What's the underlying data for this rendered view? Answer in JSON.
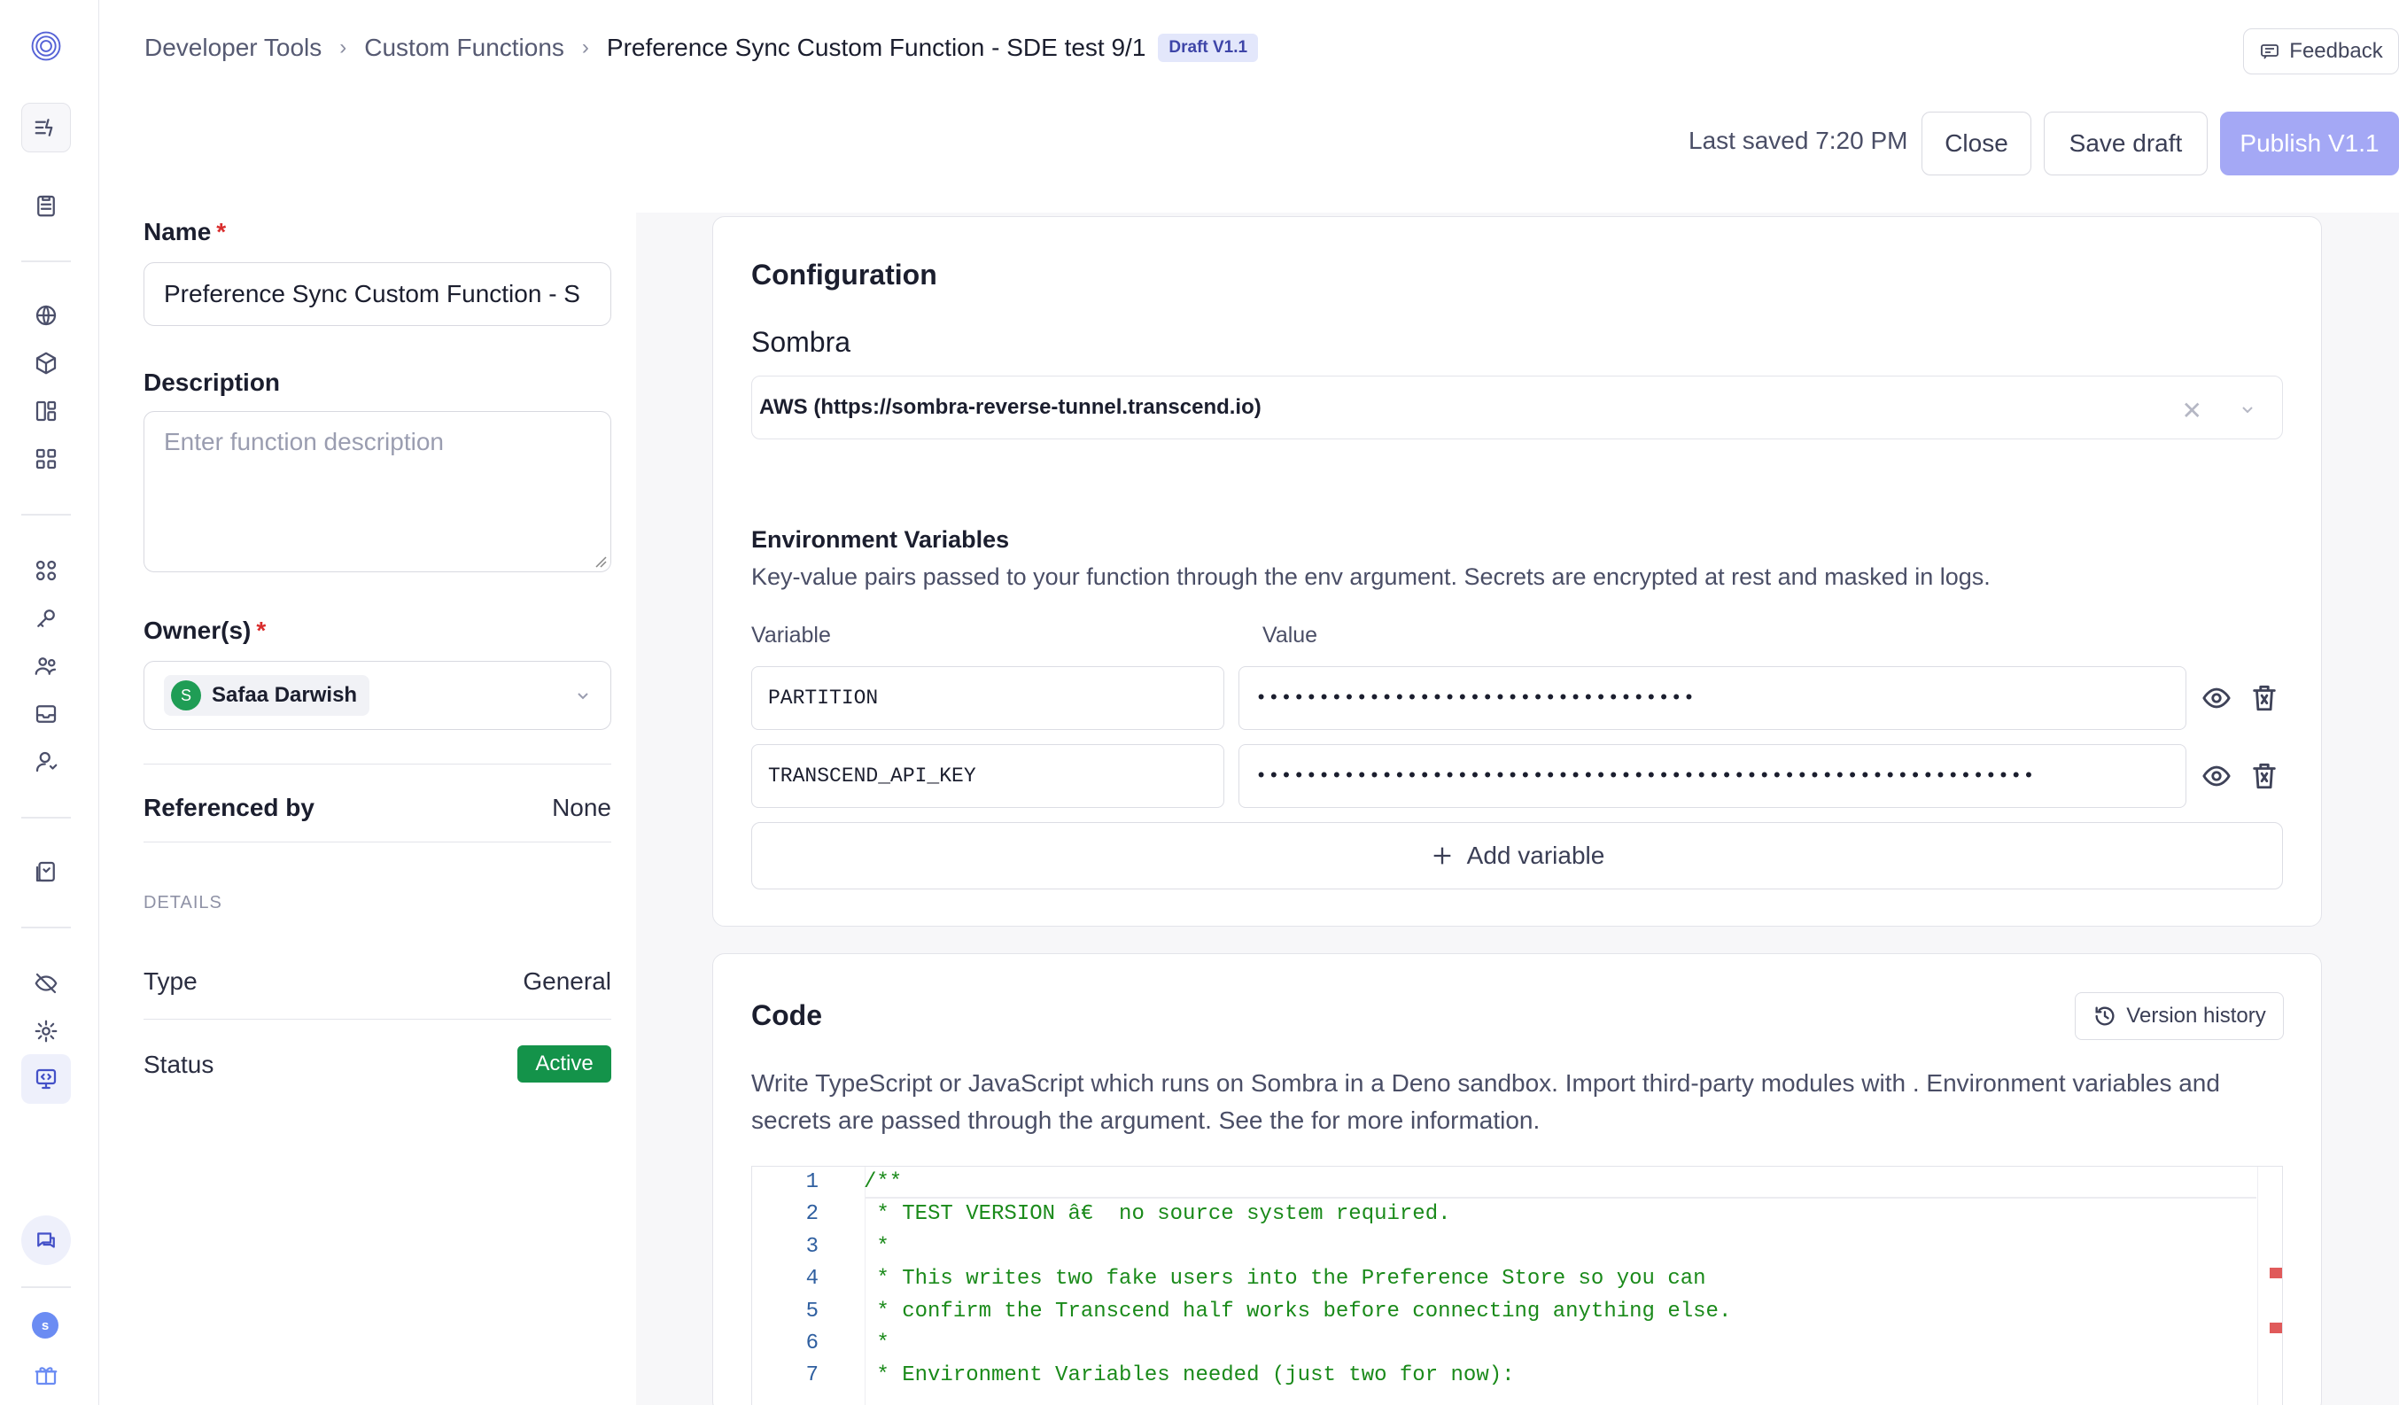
{
  "breadcrumb": {
    "items": [
      "Developer Tools",
      "Custom Functions"
    ],
    "current": "Preference Sync Custom Function - SDE test 9/1",
    "badge": "Draft V1.1"
  },
  "header": {
    "feedback_label": "Feedback",
    "last_saved": "Last saved 7:20 PM",
    "close_label": "Close",
    "save_draft_label": "Save draft",
    "publish_label": "Publish V1.1"
  },
  "form": {
    "name_label": "Name",
    "required_mark": "*",
    "name_value": "Preference Sync Custom Function - S",
    "description_label": "Description",
    "description_placeholder": "Enter function description",
    "owners_label": "Owner(s)",
    "owner_initial": "S",
    "owner_name": "Safaa Darwish",
    "referenced_by_label": "Referenced by",
    "referenced_by_value": "None",
    "details_heading": "DETAILS",
    "type_label": "Type",
    "type_value": "General",
    "status_label": "Status",
    "status_value": "Active"
  },
  "configuration": {
    "title": "Configuration",
    "sombra_label": "Sombra",
    "sombra_value": "AWS (https://sombra-reverse-tunnel.transcend.io)",
    "env_title": "Environment Variables",
    "env_description": "Key-value pairs passed to your function through the env argument. Secrets are encrypted at rest and masked in logs.",
    "col_variable": "Variable",
    "col_value": "Value",
    "variables": [
      {
        "name": "PARTITION",
        "value": "•••••••••••••••••••••••••••••••••••"
      },
      {
        "name": "TRANSCEND_API_KEY",
        "value": "••••••••••••••••••••••••••••••••••••••••••••••••••••••••••••••"
      }
    ],
    "add_variable_label": "Add variable"
  },
  "code": {
    "title": "Code",
    "version_history_label": "Version history",
    "description": "Write TypeScript or JavaScript which runs on Sombra in a Deno sandbox. Import third-party modules with . Environment variables and secrets are passed through the argument. See the for more information.",
    "lines": [
      {
        "n": "1",
        "text": "/**"
      },
      {
        "n": "2",
        "text": " * TEST VERSION â€  no source system required."
      },
      {
        "n": "3",
        "text": " *"
      },
      {
        "n": "4",
        "text": " * This writes two fake users into the Preference Store so you can"
      },
      {
        "n": "5",
        "text": " * confirm the Transcend half works before connecting anything else."
      },
      {
        "n": "6",
        "text": " *"
      },
      {
        "n": "7",
        "text": " * Environment Variables needed (just two for now):"
      }
    ]
  },
  "rail": {
    "avatar_initial": "s"
  },
  "colors": {
    "accent": "#a4a8f5",
    "status_active": "#14934a",
    "code_comment": "#1a8a1a",
    "line_number": "#2f5fa0"
  }
}
